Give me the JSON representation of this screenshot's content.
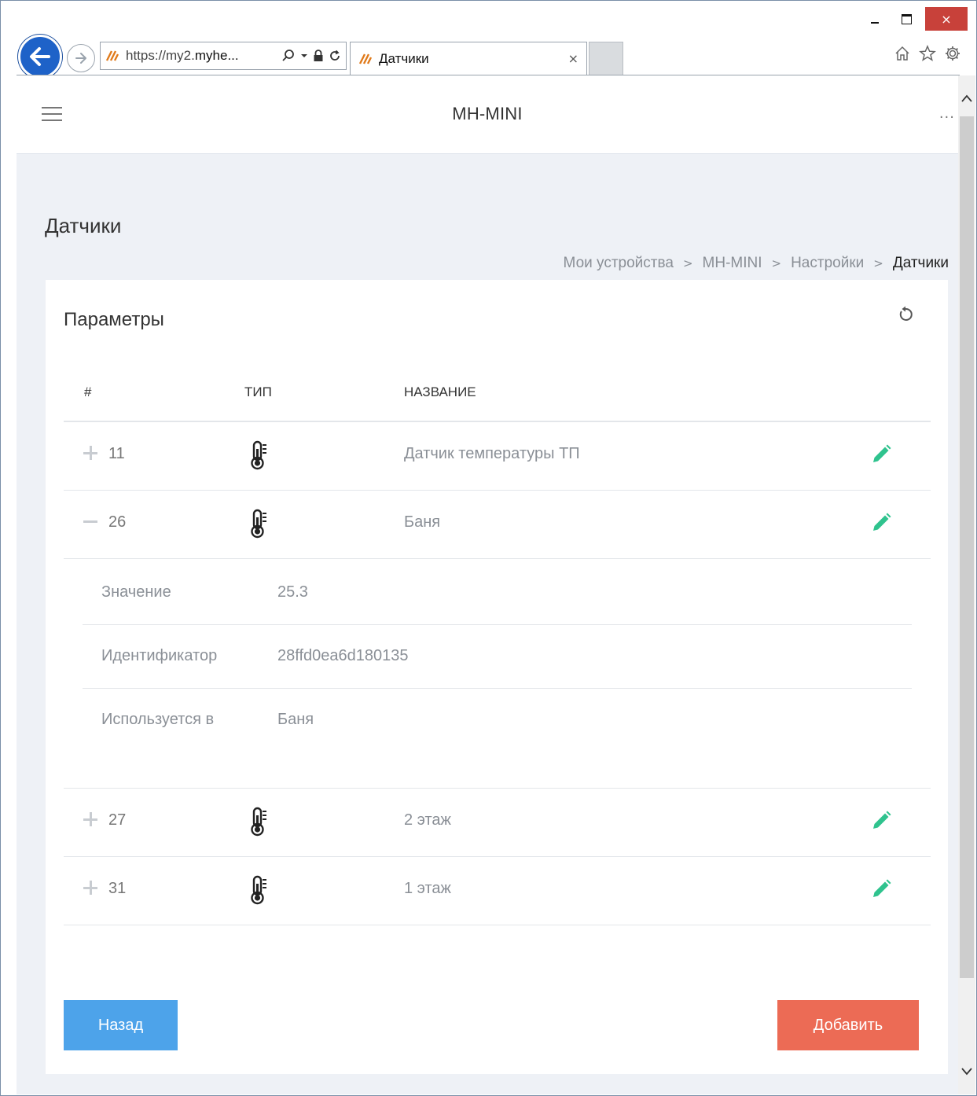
{
  "browser": {
    "url_prefix": "https://my2.",
    "url_host": "myhe...",
    "tab_title": "Датчики",
    "tab_close": "×"
  },
  "window": {
    "close_glyph": "×"
  },
  "app": {
    "title": "MH-MINI",
    "more": "..."
  },
  "page": {
    "title": "Датчики"
  },
  "breadcrumb": {
    "items": [
      "Мои устройства",
      "MH-MINI",
      "Настройки",
      "Датчики"
    ],
    "separator": ">"
  },
  "card": {
    "title": "Параметры"
  },
  "table": {
    "headers": {
      "num": "#",
      "type": "ТИП",
      "name": "НАЗВАНИЕ"
    },
    "rows": [
      {
        "id": "11",
        "name": "Датчик температуры ТП",
        "expanded": false
      },
      {
        "id": "26",
        "name": "Баня",
        "expanded": true
      },
      {
        "id": "27",
        "name": "2 этаж",
        "expanded": false
      },
      {
        "id": "31",
        "name": "1 этаж",
        "expanded": false
      }
    ]
  },
  "details": {
    "value_label": "Значение",
    "value": "25.3",
    "id_label": "Идентификатор",
    "id_value": "28ffd0ea6d180135",
    "used_label": "Используется в",
    "used_value": "Баня"
  },
  "buttons": {
    "back": "Назад",
    "add": "Добавить"
  },
  "colors": {
    "back_button": "#4da3ea",
    "add_button": "#ec6b55",
    "edit_icon": "#2fc38e",
    "background": "#eef1f6"
  },
  "icons": {
    "type": "thermometer-icon",
    "edit": "pencil-icon",
    "refresh": "refresh-icon"
  }
}
